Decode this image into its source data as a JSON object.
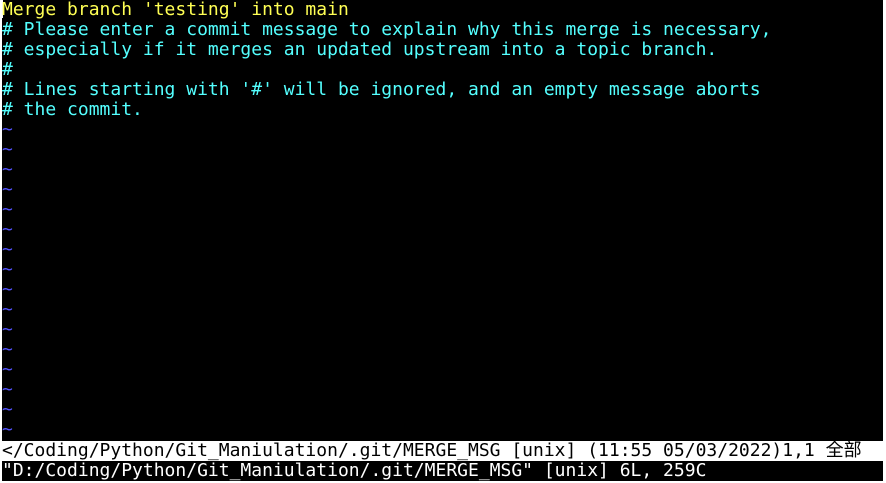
{
  "editor": {
    "lines": [
      {
        "type": "message",
        "text": "Merge branch 'testing' into main"
      },
      {
        "type": "comment",
        "text": "# Please enter a commit message to explain why this merge is necessary,"
      },
      {
        "type": "comment",
        "text": "# especially if it merges an updated upstream into a topic branch."
      },
      {
        "type": "comment",
        "text": "#"
      },
      {
        "type": "comment",
        "text": "# Lines starting with '#' will be ignored, and an empty message aborts"
      },
      {
        "type": "comment",
        "text": "# the commit."
      },
      {
        "type": "tilde",
        "text": "~"
      },
      {
        "type": "tilde",
        "text": "~"
      },
      {
        "type": "tilde",
        "text": "~"
      },
      {
        "type": "tilde",
        "text": "~"
      },
      {
        "type": "tilde",
        "text": "~"
      },
      {
        "type": "tilde",
        "text": "~"
      },
      {
        "type": "tilde",
        "text": "~"
      },
      {
        "type": "tilde",
        "text": "~"
      },
      {
        "type": "tilde",
        "text": "~"
      },
      {
        "type": "tilde",
        "text": "~"
      },
      {
        "type": "tilde",
        "text": "~"
      },
      {
        "type": "tilde",
        "text": "~"
      },
      {
        "type": "tilde",
        "text": "~"
      },
      {
        "type": "tilde",
        "text": "~"
      },
      {
        "type": "tilde",
        "text": "~"
      },
      {
        "type": "tilde",
        "text": "~"
      }
    ]
  },
  "statusline": {
    "text": "</Coding/Python/Git_Maniulation/.git/MERGE_MSG [unix] (11:55 05/03/2022)1,1 全部"
  },
  "cmdline": {
    "text": "\"D:/Coding/Python/Git_Maniulation/.git/MERGE_MSG\" [unix] 6L, 259C"
  },
  "colors": {
    "message": "#ffff54",
    "comment": "#54ffff",
    "tilde": "#5454ff",
    "background": "#000000",
    "statusline_bg": "#ffffff"
  }
}
